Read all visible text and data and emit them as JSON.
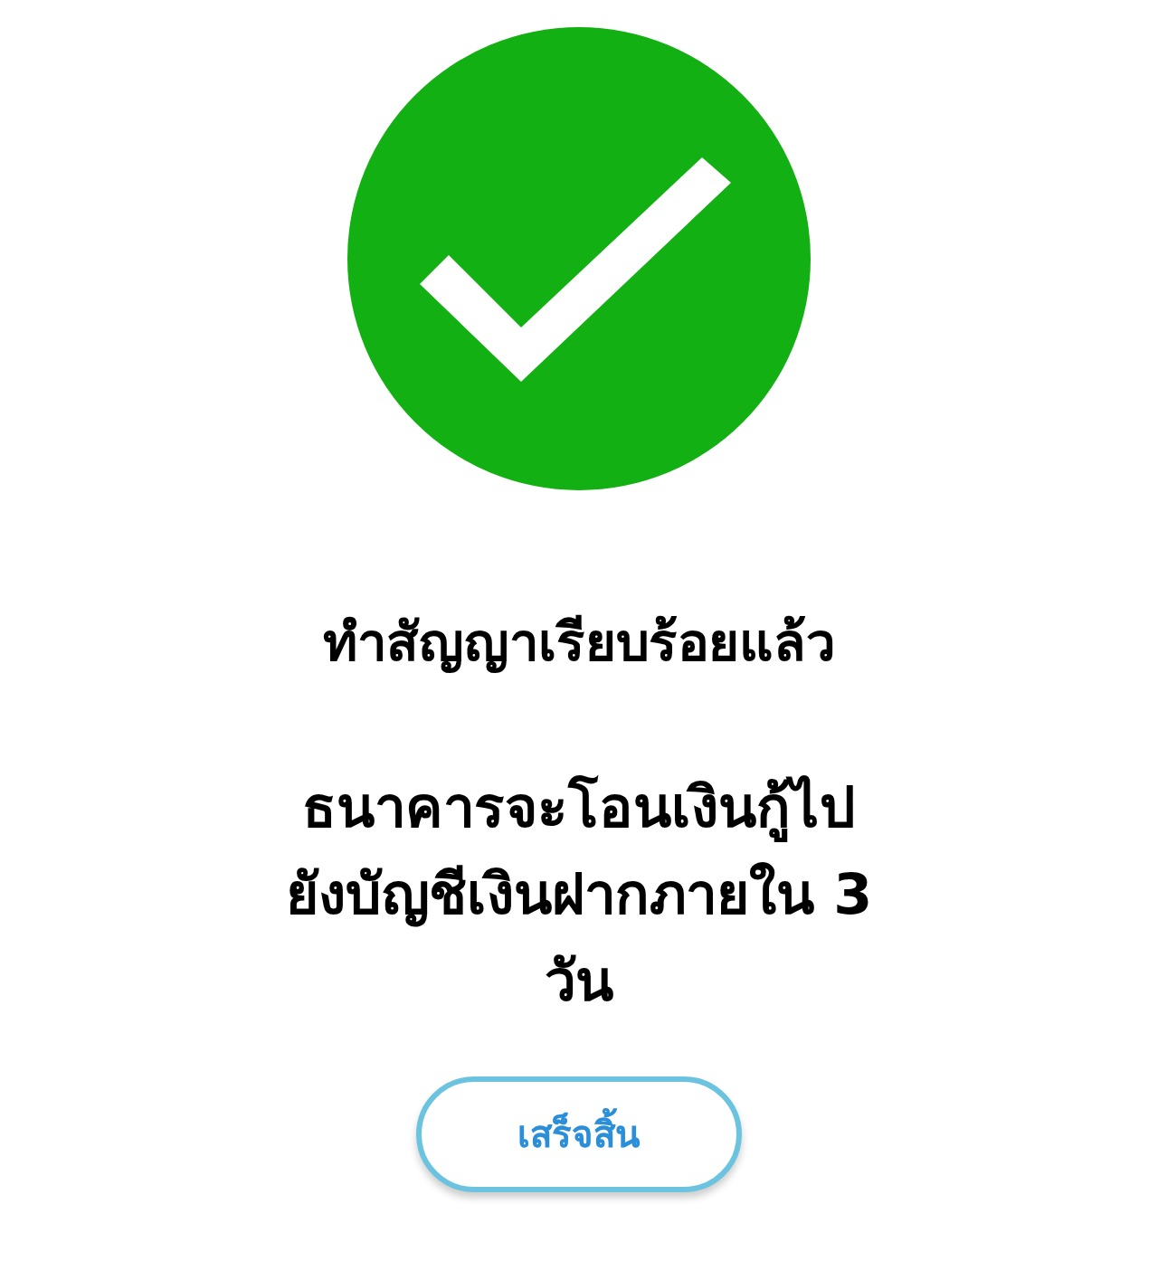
{
  "status": {
    "kind": "success"
  },
  "title": "ทำสัญญาเรียบร้อยแล้ว",
  "message_lines": [
    "ธนาคารจะโอนเงินกู้ไป",
    "ยังบัญชีเงินฝากภายใน 3",
    "วัน"
  ],
  "button": {
    "label": "เสร็จสิ้น"
  }
}
